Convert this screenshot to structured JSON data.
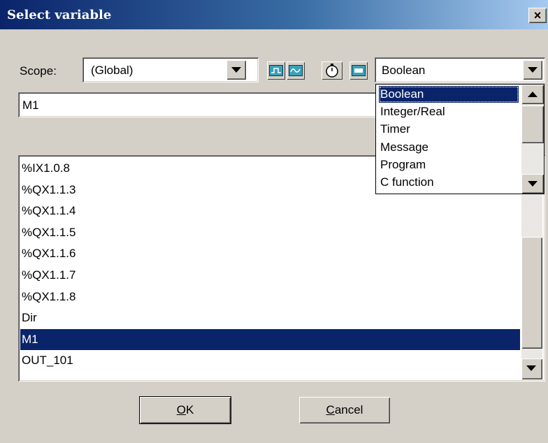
{
  "window": {
    "title": "Select variable",
    "close_label": "×"
  },
  "scope": {
    "label": "Scope:",
    "value": "(Global)"
  },
  "toolbar": {
    "icons": [
      "io-icon",
      "analog-icon",
      "timer-icon",
      "message-icon"
    ]
  },
  "type": {
    "value": "Boolean",
    "options": [
      "Boolean",
      "Integer/Real",
      "Timer",
      "Message",
      "Program",
      "C function"
    ],
    "selected_index": 0
  },
  "name_input": {
    "value": "M1"
  },
  "variables": {
    "items": [
      "%IX1.0.8",
      "%QX1.1.3",
      "%QX1.1.4",
      "%QX1.1.5",
      "%QX1.1.6",
      "%QX1.1.7",
      "%QX1.1.8",
      "Dir",
      "M1",
      "OUT_101"
    ],
    "selected": "M1"
  },
  "buttons": {
    "ok_mnemonic": "O",
    "ok_rest": "K",
    "cancel_mnemonic": "C",
    "cancel_rest": "ancel"
  },
  "colors": {
    "selection": "#0a246a",
    "face": "#d4d0c8",
    "title_start": "#0a246a",
    "title_end": "#a6caf0"
  }
}
